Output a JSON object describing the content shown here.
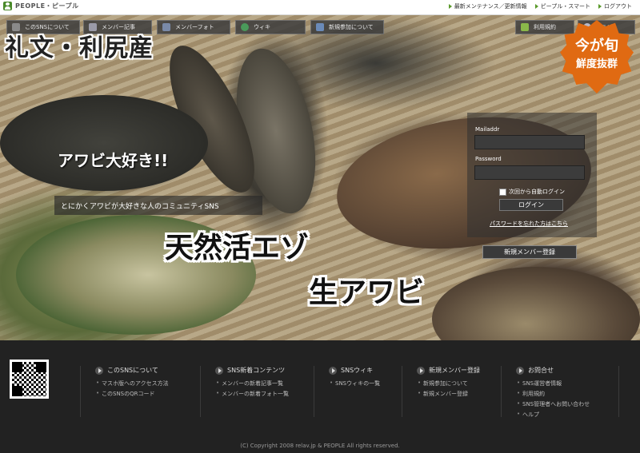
{
  "header": {
    "logo_text": "PEOPLE・ピープル",
    "links": [
      "最新メンテナンス／更新情報",
      "ピープル・スマート",
      "ログアウト"
    ]
  },
  "nav": {
    "left_tabs": [
      "このSNSについて",
      "メンバー記事",
      "メンバーフォト",
      "ウィキ",
      "新規参加について"
    ],
    "right_tabs": [
      "利用規約",
      "ヘルプ"
    ]
  },
  "hero": {
    "brand_title": "礼文・利尻産",
    "badge_line1": "今が旬",
    "badge_line2": "鮮度抜群",
    "community_title": "アワビ大好き!!",
    "community_desc": "とにかくアワビが大好きな人のコミュニティSNS",
    "wild_text": "天然活エゾ",
    "raw_text": "生アワビ"
  },
  "login": {
    "mail_label": "Mailaddr",
    "password_label": "Password",
    "auto_login_label": "次回から自動ログイン",
    "login_button": "ログイン",
    "forgot_link": "パスワードを忘れた方はこちら",
    "register_button": "新規メンバー登録"
  },
  "footer": {
    "columns": [
      {
        "title": "このSNSについて",
        "items": [
          "マスホ版へのアクセス方法",
          "このSNSのQRコード"
        ]
      },
      {
        "title": "SNS新着コンテンツ",
        "items": [
          "メンバーの新着記事一覧",
          "メンバーの新着フォト一覧"
        ]
      },
      {
        "title": "SNSウィキ",
        "items": [
          "SNSウィキの一覧"
        ]
      },
      {
        "title": "新規メンバー登録",
        "items": [
          "新規参加について",
          "新規メンバー登録"
        ]
      },
      {
        "title": "お問合せ",
        "items": [
          "SNS運営者情報",
          "利用規約",
          "SNS管理者へお問い合わせ",
          "ヘルプ"
        ]
      }
    ],
    "copyright": "(C) Copyright 2008 relav.jp & PEOPLE All rights reserved."
  },
  "colors": {
    "accent": "#4a8a2a",
    "badge": "#e06a12",
    "footer_bg": "#222222"
  }
}
